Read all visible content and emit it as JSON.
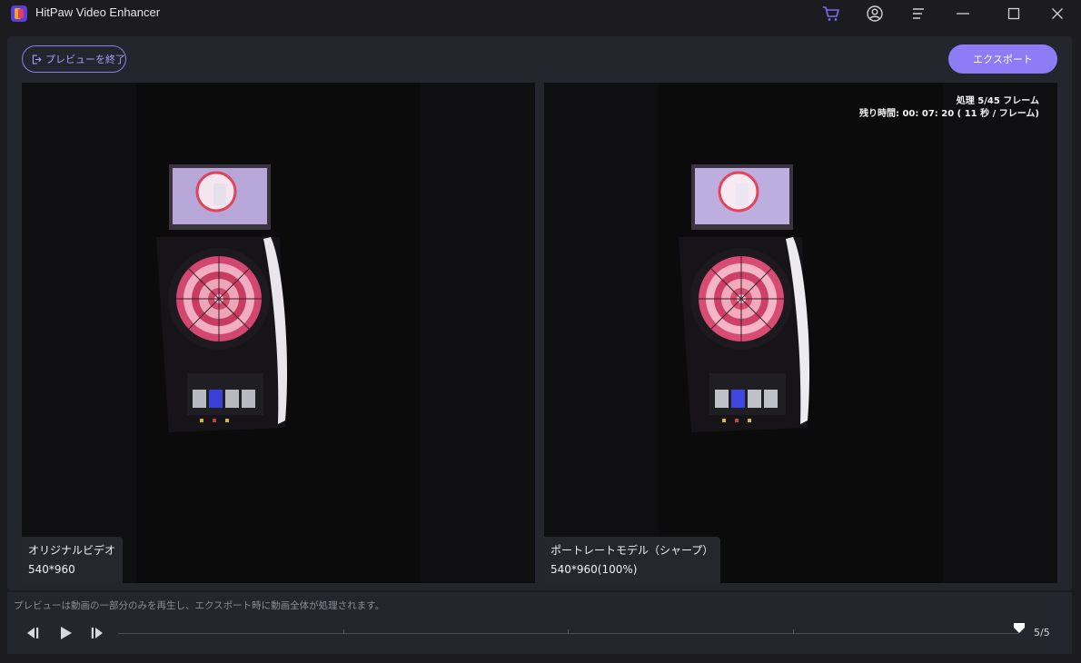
{
  "window": {
    "title": "HitPaw Video Enhancer",
    "icons": [
      "cart-icon",
      "account-icon",
      "menu-icon",
      "minimize-icon",
      "maximize-icon",
      "close-icon"
    ]
  },
  "toolbar": {
    "exit_preview_label": "プレビューを終了",
    "export_label": "エクスポート"
  },
  "left_pane": {
    "name": "オリジナルビデオ",
    "resolution": "540*960"
  },
  "right_pane": {
    "name": "ポートレートモデル（シャープ）",
    "resolution": "540*960(100%)",
    "processing_line": "処理 5/45 フレーム",
    "remaining_line": "残り時間: 00: 07: 20 ( 11 秒 / フレーム)"
  },
  "footer": {
    "notice": "プレビューは動画の一部分のみを再生し、エクスポート時に動画全体が処理されます。",
    "frame_counter": "5/5",
    "current_frame": 5,
    "total_frames": 5
  },
  "colors": {
    "accent": "#8e7bf5",
    "accent_text": "#a89cff",
    "background": "#1b1b20",
    "panel": "#25252d",
    "cart_icon": "#7b6cf0"
  }
}
